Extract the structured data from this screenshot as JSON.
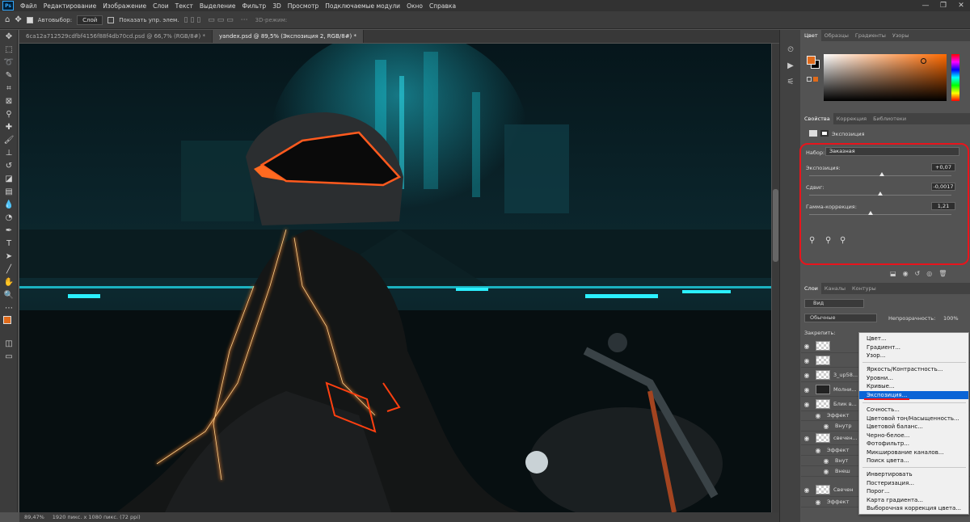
{
  "app": {
    "logo": "Ps"
  },
  "menubar": {
    "items": [
      "Файл",
      "Редактирование",
      "Изображение",
      "Слои",
      "Текст",
      "Выделение",
      "Фильтр",
      "3D",
      "Просмотр",
      "Подключаемые модули",
      "Окно",
      "Справка"
    ],
    "window_controls": [
      "—",
      "❐",
      "✕"
    ]
  },
  "options": {
    "autoselect_label": "Автовыбор:",
    "autoselect_value": "Слой",
    "show_transform_label": "Показать упр. элем.",
    "mode_3d_label": "3D-режим:"
  },
  "tabs": [
    {
      "label": "6ca12a712529cdfbf4156f88f4db70cd.psd @ 66,7% (RGB/8#) *"
    },
    {
      "label": "yandex.psd @ 89,5% (Экспозиция 2, RGB/8#) *"
    }
  ],
  "status": {
    "zoom": "89,47%",
    "doc_info": "1920 пикс. x 1080 пикс. (72 ppi)"
  },
  "color_panel": {
    "tabs": [
      "Цвет",
      "Образцы",
      "Градиенты",
      "Узоры"
    ],
    "foreground": "#e06a1a",
    "background": "#000000"
  },
  "properties": {
    "tabs": [
      "Свойства",
      "Коррекция",
      "Библиотеки"
    ],
    "header": "Экспозиция",
    "preset_label": "Набор:",
    "preset_value": "Заказная",
    "sliders": [
      {
        "label": "Экспозиция:",
        "value": "+0,07",
        "level": 0.51
      },
      {
        "label": "Сдвиг:",
        "value": "-0,0017",
        "level": 0.5
      },
      {
        "label": "Гамма-коррекция:",
        "value": "1,21",
        "level": 0.43
      }
    ]
  },
  "layers": {
    "tabs": [
      "Слои",
      "Каналы",
      "Контуры"
    ],
    "kind_filter": "Вид",
    "blend_mode": "Обычные",
    "opacity_label": "Непрозрачность:",
    "opacity_value": "100%",
    "lock_label": "Закрепить:",
    "rows": [
      {
        "name": ""
      },
      {
        "name": ""
      },
      {
        "name": "3_up58..."
      },
      {
        "name": "Молни..."
      },
      {
        "name": "Блик в..."
      },
      {
        "name": "Эффект"
      },
      {
        "name": "Внутр"
      },
      {
        "name": "свечен..."
      },
      {
        "name": "Эффект"
      },
      {
        "name": "Внут"
      },
      {
        "name": "Внеш"
      },
      {
        "name": "Свечен"
      },
      {
        "name": "Эффект"
      }
    ]
  },
  "context_menu": {
    "items": [
      "Цвет...",
      "Градиент...",
      "Узор...",
      "Яркость/Контрастность...",
      "Уровни...",
      "Кривые...",
      "Экспозиция...",
      "Сочность...",
      "Цветовой тон/Насыщенность...",
      "Цветовой баланс...",
      "Черно-белое...",
      "Фотофильтр...",
      "Микширование каналов...",
      "Поиск цвета...",
      "Инвертировать",
      "Постеризация...",
      "Порог...",
      "Карта градиента...",
      "Выборочная коррекция цвета..."
    ],
    "highlighted": "Экспозиция..."
  }
}
